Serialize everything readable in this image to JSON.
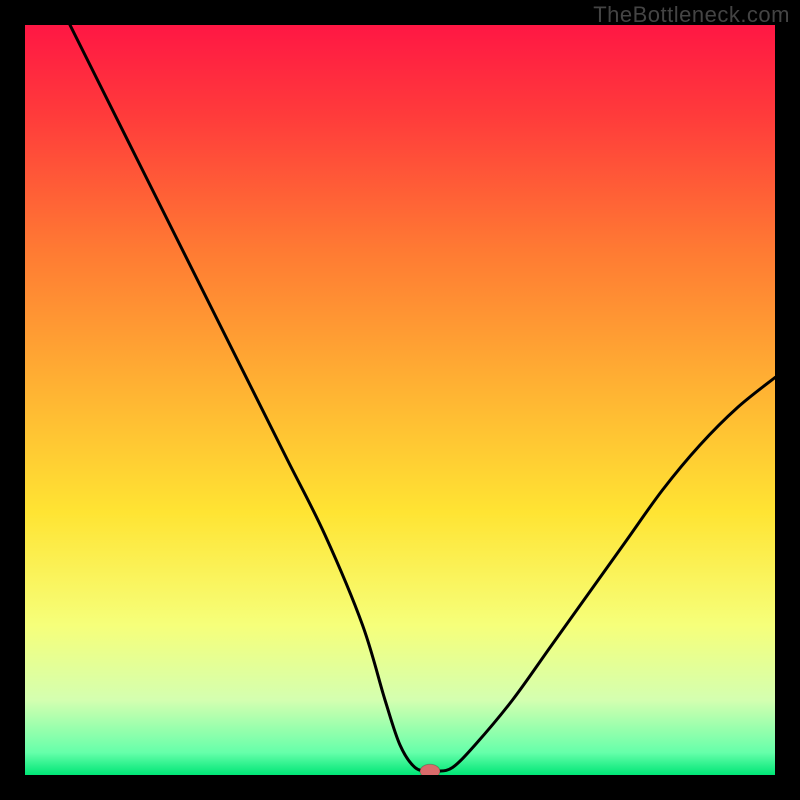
{
  "watermark": "TheBottleneck.com",
  "chart_data": {
    "type": "line",
    "title": "",
    "xlabel": "",
    "ylabel": "",
    "xlim": [
      0,
      100
    ],
    "ylim": [
      0,
      100
    ],
    "background": {
      "type": "vertical-gradient",
      "stops": [
        {
          "pos": 0.0,
          "color": "#ff1744"
        },
        {
          "pos": 0.12,
          "color": "#ff3b3b"
        },
        {
          "pos": 0.3,
          "color": "#ff7a33"
        },
        {
          "pos": 0.5,
          "color": "#ffb733"
        },
        {
          "pos": 0.65,
          "color": "#ffe433"
        },
        {
          "pos": 0.8,
          "color": "#f6ff7a"
        },
        {
          "pos": 0.9,
          "color": "#d4ffb0"
        },
        {
          "pos": 0.97,
          "color": "#66ffaa"
        },
        {
          "pos": 1.0,
          "color": "#00e676"
        }
      ]
    },
    "series": [
      {
        "name": "bottleneck-curve",
        "color": "#000000",
        "x": [
          6,
          10,
          15,
          20,
          25,
          30,
          35,
          40,
          45,
          48,
          50,
          52,
          54,
          55,
          57,
          60,
          65,
          70,
          75,
          80,
          85,
          90,
          95,
          100
        ],
        "y": [
          100,
          92,
          82,
          72,
          62,
          52,
          42,
          32,
          20,
          10,
          4,
          1,
          0.5,
          0.5,
          1,
          4,
          10,
          17,
          24,
          31,
          38,
          44,
          49,
          53
        ]
      }
    ],
    "marker": {
      "name": "optimum-point",
      "x": 54,
      "y": 0.5,
      "color": "#d96b6b"
    }
  }
}
